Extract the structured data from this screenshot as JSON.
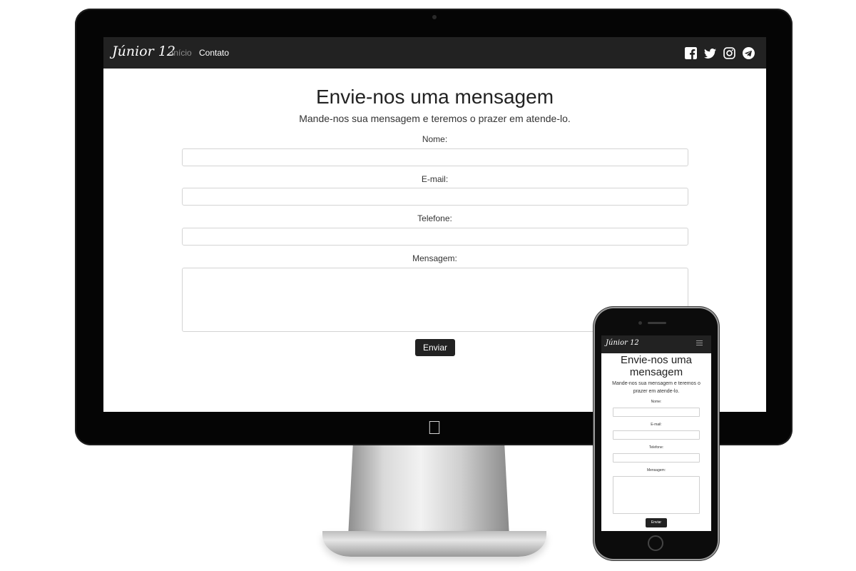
{
  "brand": "Júnior 12",
  "nav": {
    "inicio": "Início",
    "contato": "Contato"
  },
  "social_icons": [
    "facebook-icon",
    "twitter-icon",
    "instagram-icon",
    "telegram-icon"
  ],
  "form": {
    "title": "Envie-nos uma mensagem",
    "subtitle": "Mande-nos sua mensagem e teremos o prazer em atende-lo.",
    "name_label": "Nome:",
    "name_value": "",
    "email_label": "E-mail:",
    "email_value": "",
    "phone_label": "Telefone:",
    "phone_value": "",
    "message_label": "Mensagem:",
    "message_value": "",
    "submit": "Enviar"
  },
  "colors": {
    "navbar": "#222222",
    "button": "#222222",
    "active_link": "#ffffff",
    "inactive_link": "#8c8c8c"
  }
}
